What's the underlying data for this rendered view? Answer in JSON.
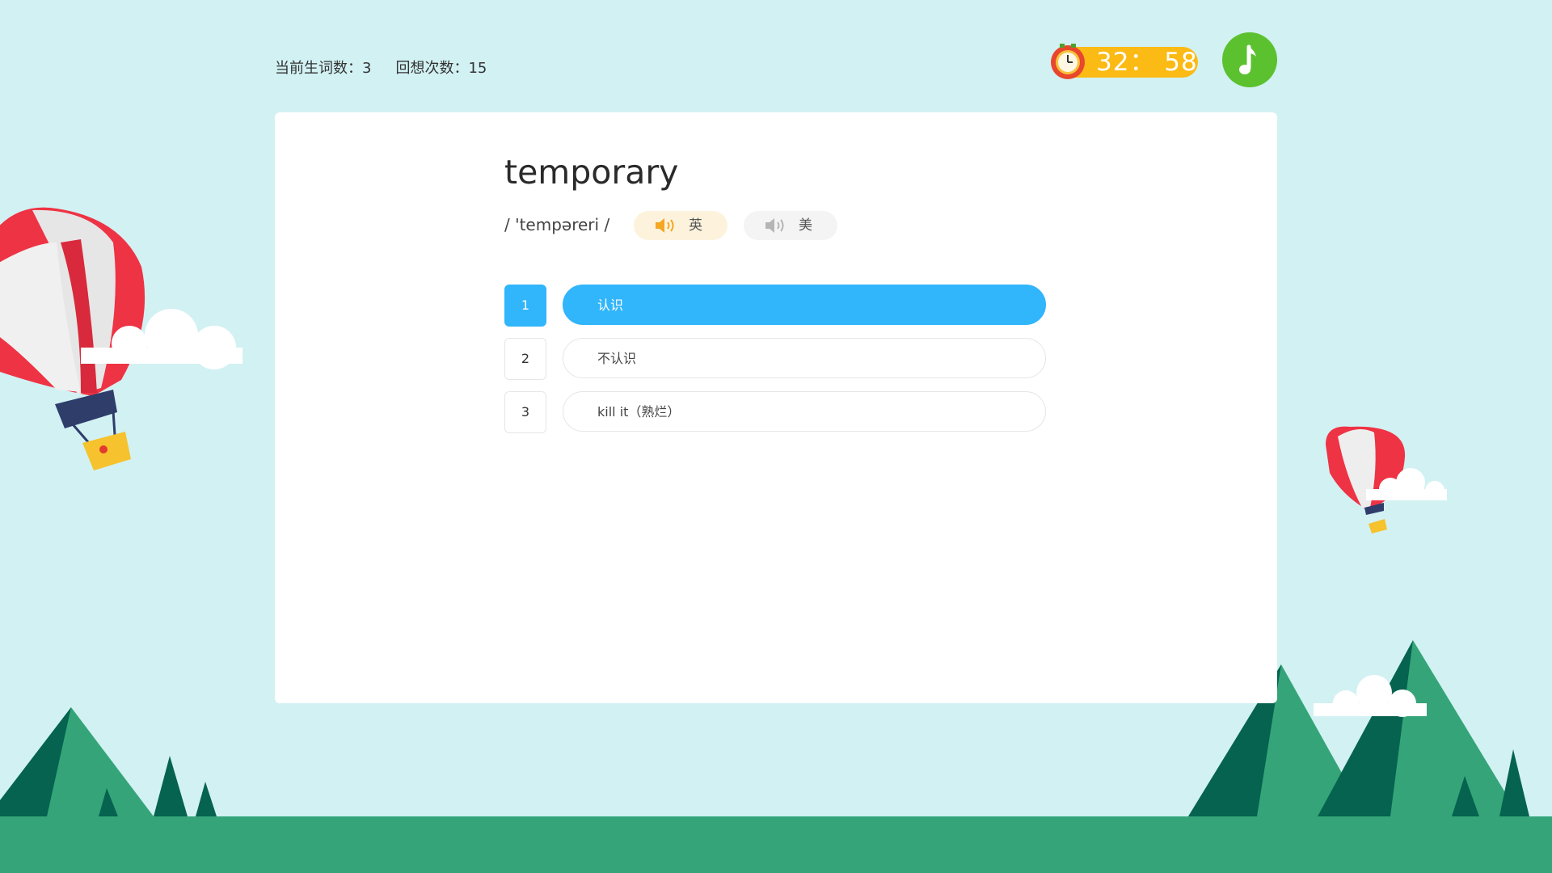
{
  "stats": {
    "new_words_label": "当前生词数：3",
    "recall_label": "回想次数：15"
  },
  "timer": {
    "time": "32： 58",
    "icon": "alarm-clock-icon"
  },
  "music": {
    "icon": "music-note-icon"
  },
  "word": {
    "text": "temporary",
    "phonetic": "/ 'tempəreri /"
  },
  "pronunciations": [
    {
      "label": "英",
      "icon": "speaker-icon",
      "active": true
    },
    {
      "label": "美",
      "icon": "speaker-icon",
      "active": false
    }
  ],
  "options": [
    {
      "number": "1",
      "label": "认识",
      "selected": true
    },
    {
      "number": "2",
      "label": "不认识",
      "selected": false
    },
    {
      "number": "3",
      "label": "kill it（熟烂）",
      "selected": false
    }
  ],
  "colors": {
    "background": "#d2f1f3",
    "accent": "#31b5fb",
    "timer": "#fbba14",
    "music": "#5cc12f",
    "ground": "#35a579"
  }
}
